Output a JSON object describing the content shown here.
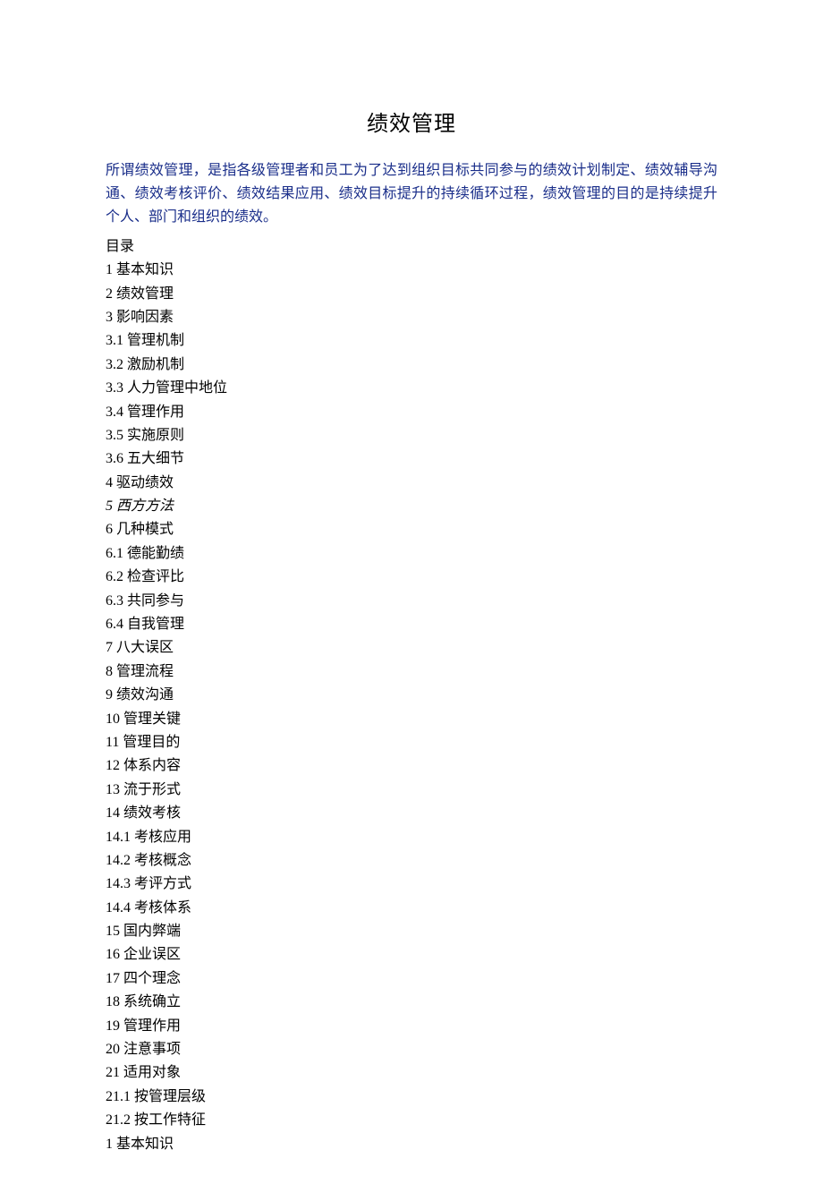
{
  "title": "绩效管理",
  "intro": "所谓绩效管理，是指各级管理者和员工为了达到组织目标共同参与的绩效计划制定、绩效辅导沟通、绩效考核评价、绩效结果应用、绩效目标提升的持续循环过程，绩效管理的目的是持续提升个人、部门和组织的绩效。",
  "toc_heading": "目录",
  "toc": [
    "1 基本知识",
    "2 绩效管理",
    "3 影响因素",
    "3.1 管理机制",
    "3.2 激励机制",
    "3.3 人力管理中地位",
    "3.4 管理作用",
    "3.5 实施原则",
    "3.6 五大细节",
    "4 驱动绩效",
    "5 西方方法",
    "6 几种模式",
    "6.1 德能勤绩",
    "6.2 检查评比",
    "6.3 共同参与",
    "6.4 自我管理",
    "7 八大误区",
    "8 管理流程",
    "9 绩效沟通",
    "10 管理关键",
    "11 管理目的",
    "12 体系内容",
    "13 流于形式",
    "14 绩效考核",
    "14.1 考核应用",
    "14.2 考核概念",
    "14.3 考评方式",
    "14.4 考核体系",
    "15 国内弊端",
    "16 企业误区",
    "17 四个理念",
    "18 系统确立",
    "19 管理作用",
    "20 注意事项",
    "21 适用对象",
    "21.1 按管理层级",
    "21.2 按工作特征",
    "1 基本知识"
  ]
}
